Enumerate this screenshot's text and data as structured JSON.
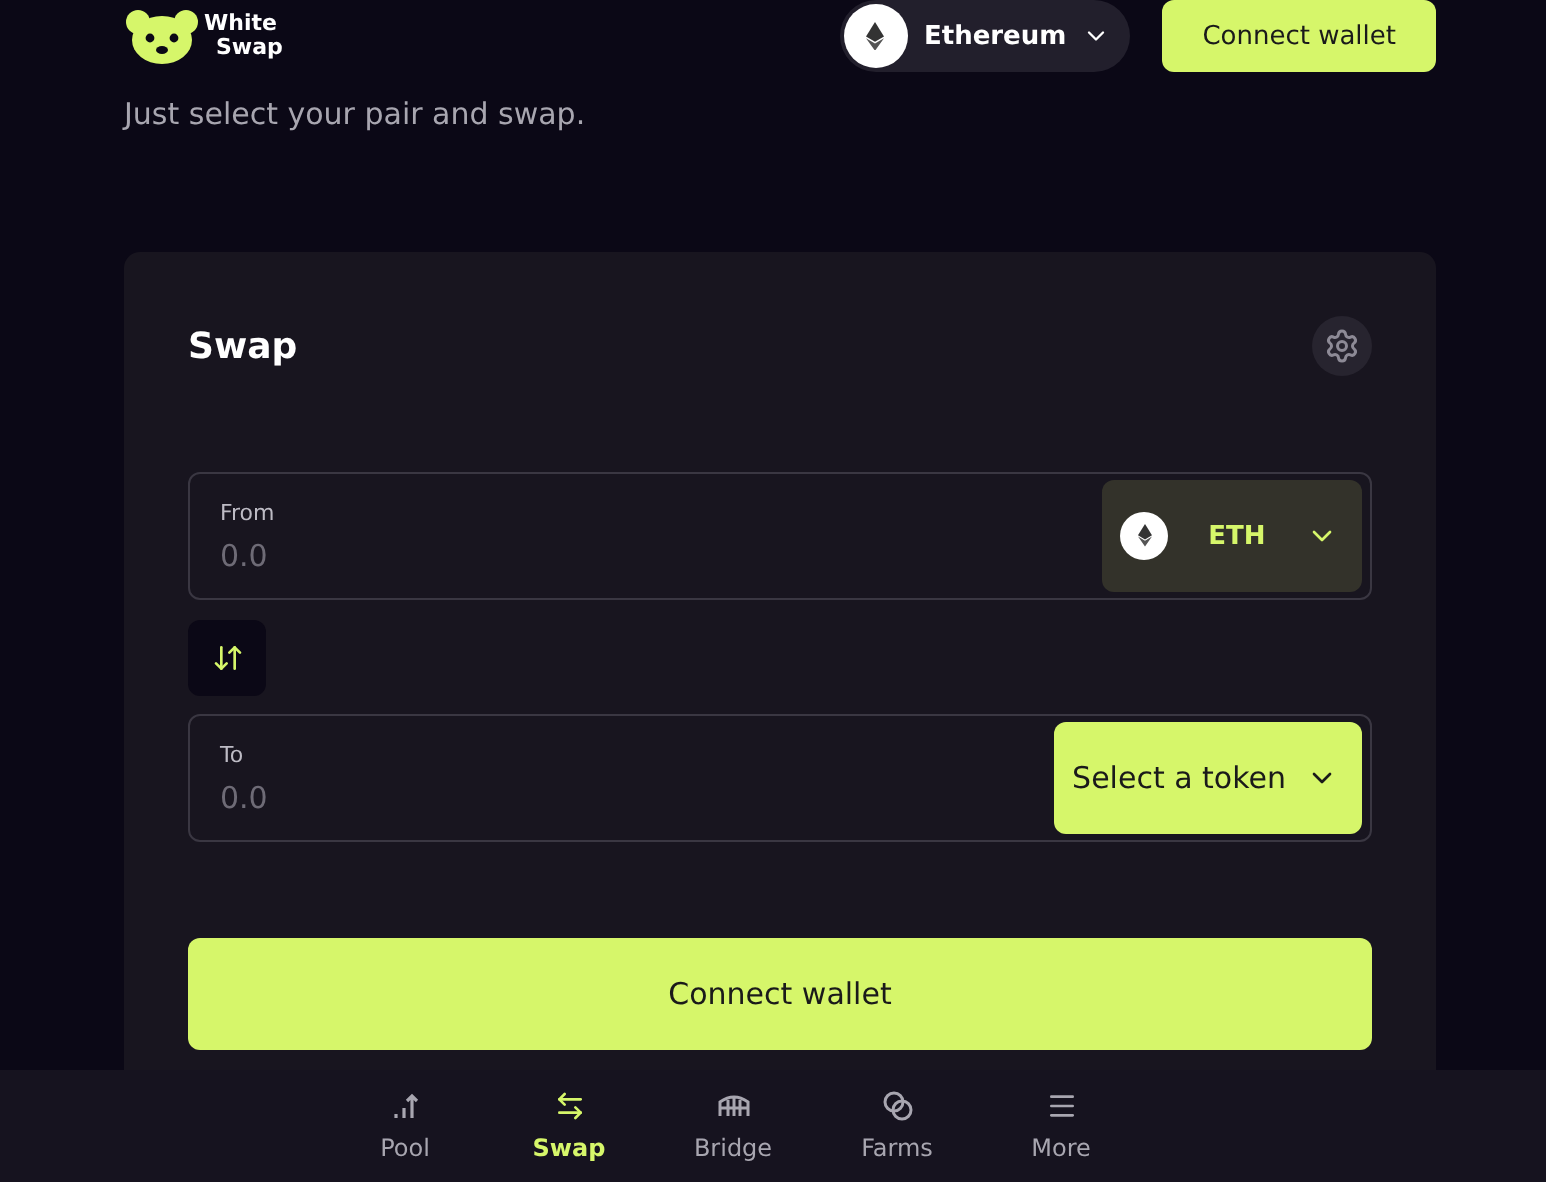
{
  "header": {
    "brand": [
      "White",
      "Swap"
    ],
    "network": {
      "label": "Ethereum"
    },
    "connect_button": "Connect wallet"
  },
  "subtitle": "Just select your pair and swap.",
  "swap_card": {
    "title": "Swap",
    "from": {
      "label": "From",
      "placeholder": "0.0",
      "token": {
        "kind": "chosen",
        "symbol": "ETH"
      }
    },
    "to": {
      "label": "To",
      "placeholder": "0.0",
      "token": {
        "kind": "select",
        "symbol": "Select a token"
      }
    },
    "connect_button": "Connect wallet"
  },
  "bottom_nav": [
    {
      "label": "Pool",
      "selected": false
    },
    {
      "label": "Swap",
      "selected": true
    },
    {
      "label": "Bridge",
      "selected": false
    },
    {
      "label": "Farms",
      "selected": false
    },
    {
      "label": "More",
      "selected": false
    }
  ]
}
